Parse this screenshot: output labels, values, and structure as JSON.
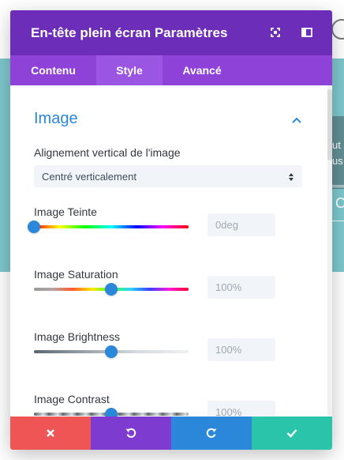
{
  "modal": {
    "title": "En-tête plein écran Paramètres"
  },
  "tabs": [
    {
      "label": "Contenu"
    },
    {
      "label": "Style"
    },
    {
      "label": "Avancé"
    }
  ],
  "active_tab": "Style",
  "section": {
    "title": "Image",
    "expanded": true
  },
  "fields": {
    "vertical_alignment": {
      "label": "Alignement vertical de l'image",
      "value": "Centré verticalement"
    },
    "hue": {
      "label": "Image Teinte",
      "value": "0deg",
      "level": 0.0
    },
    "saturation": {
      "label": "Image Saturation",
      "value": "100%",
      "level": 0.5
    },
    "brightness": {
      "label": "Image Brightness",
      "value": "100%",
      "level": 0.5
    },
    "contrast": {
      "label": "Image Contrast",
      "value": "100%",
      "level": 0.5
    }
  },
  "background_page": {
    "line1": "ut",
    "line2": "us",
    "big_letter": "",
    "button_letter": "C"
  },
  "colors": {
    "header": "#6c2eb9",
    "tabs": "#8e42d8",
    "active_tab": "#9b55e3",
    "accent": "#2b87da",
    "cancel": "#ef5555",
    "undo": "#7e3bd0",
    "redo": "#2b87da",
    "save": "#29c4a9",
    "background": "#7dc7cc"
  },
  "icons": {
    "header": [
      "fullscreen-icon",
      "sidebar-icon"
    ],
    "section": "chevron-up-icon",
    "footer": [
      "close-icon",
      "undo-icon",
      "redo-icon",
      "check-icon"
    ]
  }
}
